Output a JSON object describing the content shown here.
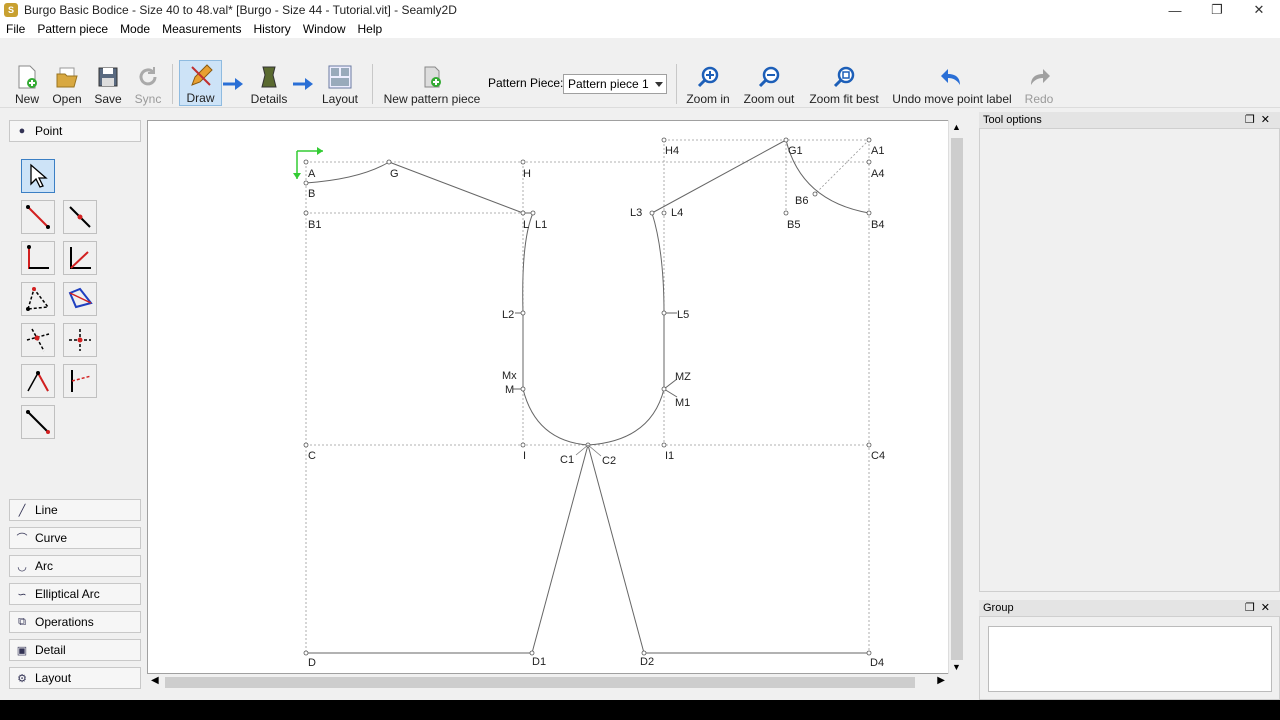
{
  "window": {
    "title": "Burgo Basic Bodice - Size 40 to 48.val* [Burgo - Size 44 - Tutorial.vit] - Seamly2D",
    "minimize": "—",
    "restore": "❐",
    "close": "✕"
  },
  "menu": [
    "File",
    "Pattern piece",
    "Mode",
    "Measurements",
    "History",
    "Window",
    "Help"
  ],
  "toolbar": {
    "new": "New",
    "open": "Open",
    "save": "Save",
    "sync": "Sync",
    "draw": "Draw",
    "details": "Details",
    "layout": "Layout",
    "new_pattern_piece": "New pattern piece",
    "pattern_piece_label": "Pattern Piece:",
    "pattern_piece_value": "Pattern piece 1",
    "zoom_in": "Zoom in",
    "zoom_out": "Zoom out",
    "zoom_fit_best": "Zoom fit best",
    "undo": "Undo move point label",
    "redo": "Redo"
  },
  "left_panel": {
    "point_group": "Point",
    "groups": [
      "Line",
      "Curve",
      "Arc",
      "Elliptical Arc",
      "Operations",
      "Detail",
      "Layout"
    ]
  },
  "docks": {
    "tool_options": "Tool options",
    "group": "Group"
  },
  "pattern_labels": {
    "A": "A",
    "G": "G",
    "H": "H",
    "H4": "H4",
    "G1": "G1",
    "A1": "A1",
    "A4": "A4",
    "B": "B",
    "B1": "B1",
    "L": "L",
    "L1": "L1",
    "L3": "L3",
    "L4": "L4",
    "B6": "B6",
    "B5": "B5",
    "B4": "B4",
    "L2": "L2",
    "L5": "L5",
    "Mx": "Mx",
    "M": "M",
    "MZ": "MZ",
    "M1": "M1",
    "C": "C",
    "I": "I",
    "C1": "C1",
    "C2": "C2",
    "I1": "I1",
    "C4": "C4",
    "D": "D",
    "D1": "D1",
    "D2": "D2",
    "D4": "D4"
  },
  "colors": {
    "accent": "#cde3f7",
    "tool_red": "#d22020",
    "axis_green": "#33cc33"
  }
}
